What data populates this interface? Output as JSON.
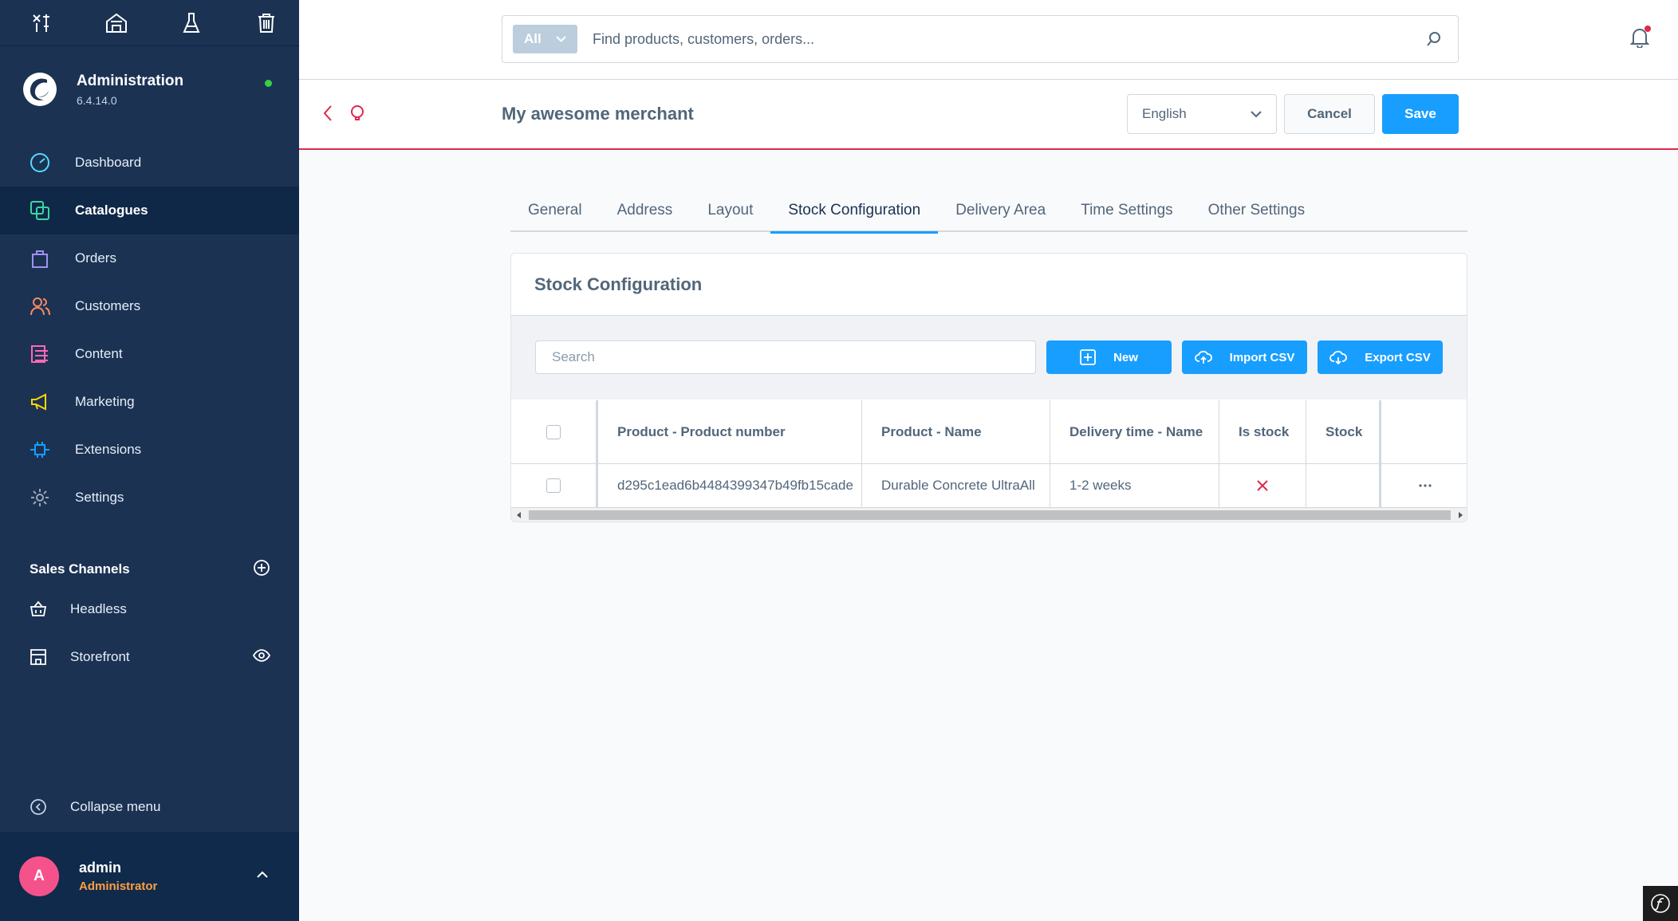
{
  "sidebar": {
    "brand": {
      "title": "Administration",
      "version": "6.4.14.0"
    },
    "nav": [
      {
        "label": "Dashboard",
        "icon": "dashboard-icon",
        "color": "#57d9ff"
      },
      {
        "label": "Catalogues",
        "icon": "catalogue-icon",
        "color": "#3ad6a1",
        "active": true
      },
      {
        "label": "Orders",
        "icon": "orders-icon",
        "color": "#a092f0"
      },
      {
        "label": "Customers",
        "icon": "customers-icon",
        "color": "#f88962"
      },
      {
        "label": "Content",
        "icon": "content-icon",
        "color": "#ff68b4"
      },
      {
        "label": "Marketing",
        "icon": "marketing-icon",
        "color": "#ffd700"
      },
      {
        "label": "Extensions",
        "icon": "extensions-icon",
        "color": "#189eff"
      },
      {
        "label": "Settings",
        "icon": "settings-icon",
        "color": "#9aa8b5"
      }
    ],
    "sales_channels": {
      "title": "Sales Channels",
      "items": [
        {
          "label": "Headless",
          "icon": "basket-icon"
        },
        {
          "label": "Storefront",
          "icon": "storefront-icon"
        }
      ]
    },
    "collapse_label": "Collapse menu",
    "user": {
      "initial": "A",
      "name": "admin",
      "role": "Administrator"
    }
  },
  "topbar": {
    "search_type": "All",
    "search_placeholder": "Find products, customers, orders..."
  },
  "smartbar": {
    "title": "My awesome merchant",
    "language": "English",
    "cancel_label": "Cancel",
    "save_label": "Save"
  },
  "tabs": [
    {
      "label": "General"
    },
    {
      "label": "Address"
    },
    {
      "label": "Layout"
    },
    {
      "label": "Stock Configuration",
      "active": true
    },
    {
      "label": "Delivery Area"
    },
    {
      "label": "Time Settings"
    },
    {
      "label": "Other Settings"
    }
  ],
  "card": {
    "title": "Stock Configuration",
    "search_placeholder": "Search",
    "buttons": {
      "new": "New",
      "import": "Import CSV",
      "export": "Export CSV"
    },
    "columns": [
      "Product - Product number",
      "Product - Name",
      "Delivery time - Name",
      "Is stock",
      "Stock"
    ],
    "rows": [
      {
        "product_number": "d295c1ead6b4484399347b49fb15cade",
        "product_name": "Durable Concrete UltraAll",
        "delivery_time": "1-2 weeks",
        "is_stock": false,
        "stock": ""
      }
    ]
  },
  "colors": {
    "sidebar_bg": "#1b3253",
    "accent": "#189eff",
    "danger": "#de294c"
  }
}
